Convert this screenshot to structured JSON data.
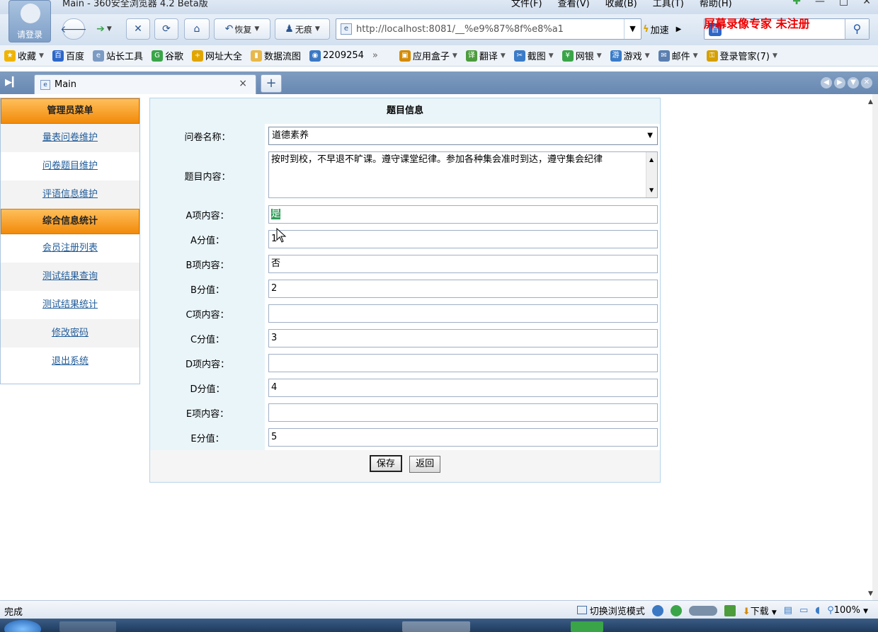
{
  "window": {
    "title": "Main - 360安全浏览器 4.2 Beta版",
    "menus": [
      "文件(F)",
      "查看(V)",
      "收藏(B)",
      "工具(T)",
      "帮助(H)"
    ]
  },
  "avatar": {
    "label": "请登录"
  },
  "toolbar": {
    "restore_label": "恢复",
    "incognito_label": "无痕",
    "url": "http://localhost:8081/__%e9%87%8f%e8%a1",
    "speed_label": "加速"
  },
  "watermark": "屏幕录像专家 未注册",
  "favorites": [
    {
      "label": "收藏",
      "icon": "star-icon",
      "color": "#f0b400"
    },
    {
      "label": "百度",
      "icon": "baidu-icon",
      "color": "#2d67c9"
    },
    {
      "label": "站长工具",
      "icon": "page-icon",
      "color": "#7b9bc4"
    },
    {
      "label": "谷歌",
      "icon": "google-icon",
      "color": "#3aa548"
    },
    {
      "label": "网址大全",
      "icon": "nav-icon",
      "color": "#e1a500"
    },
    {
      "label": "数据流图",
      "icon": "folder-icon",
      "color": "#e8b84a"
    },
    {
      "label": "2209254",
      "icon": "globe-icon",
      "color": "#3b78c4"
    }
  ],
  "favorites_more": "»",
  "favorites_right": [
    {
      "label": "应用盒子",
      "icon": "box-icon",
      "color": "#d48a00"
    },
    {
      "label": "翻译",
      "icon": "translate-icon",
      "color": "#4c9c3c"
    },
    {
      "label": "截图",
      "icon": "screenshot-icon",
      "color": "#3a7cc8"
    },
    {
      "label": "网银",
      "icon": "bank-icon",
      "color": "#3aa548"
    },
    {
      "label": "游戏",
      "icon": "game-icon",
      "color": "#3a7cc8"
    },
    {
      "label": "邮件",
      "icon": "mail-icon",
      "color": "#5a7fb0"
    },
    {
      "label": "登录管家(7)",
      "icon": "key-icon",
      "color": "#d6a000"
    }
  ],
  "tab": {
    "label": "Main"
  },
  "menu": {
    "admin_header": "管理员菜单",
    "admin_items": [
      "量表问卷维护",
      "问卷题目维护",
      "评语信息维护"
    ],
    "stats_header": "综合信息统计",
    "stats_items": [
      "会员注册列表",
      "测试结果查询",
      "测试结果统计",
      "修改密码",
      "退出系统"
    ]
  },
  "form": {
    "title": "题目信息",
    "questionnaire_label": "问卷名称：",
    "questionnaire_value": "道德素养",
    "content_label": "题目内容：",
    "content_value": "按时到校，不早退不旷课。遵守课堂纪律。参加各种集会准时到达，遵守集会纪律",
    "a_content_label": "A项内容：",
    "a_content_value": "是",
    "a_score_label": "A分值：",
    "a_score_value": "1",
    "b_content_label": "B项内容：",
    "b_content_value": "否",
    "b_score_label": "B分值：",
    "b_score_value": "2",
    "c_content_label": "C项内容：",
    "c_content_value": "",
    "c_score_label": "C分值：",
    "c_score_value": "3",
    "d_content_label": "D项内容：",
    "d_content_value": "",
    "d_score_label": "D分值：",
    "d_score_value": "4",
    "e_content_label": "E项内容：",
    "e_content_value": "",
    "e_score_label": "E分值：",
    "e_score_value": "5",
    "save_label": "保存",
    "back_label": "返回"
  },
  "status": {
    "text": "完成",
    "mode_label": "切换浏览模式",
    "download_label": "下载",
    "zoom": "100%"
  }
}
